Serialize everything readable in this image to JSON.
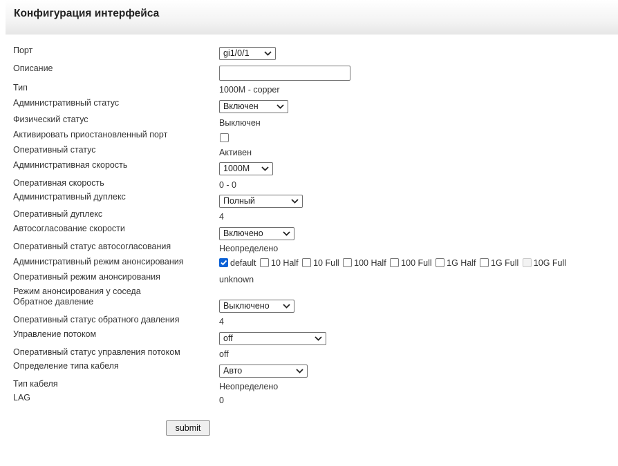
{
  "header": {
    "title": "Конфигурация интерфейса"
  },
  "form": {
    "port": {
      "label": "Порт",
      "value": "gi1/0/1"
    },
    "description": {
      "label": "Описание",
      "value": ""
    },
    "type": {
      "label": "Тип",
      "value": "1000M - copper"
    },
    "admin_status": {
      "label": "Административный статус",
      "value": "Включен"
    },
    "phys_status": {
      "label": "Физический статус",
      "value": "Выключен"
    },
    "activate_suspended": {
      "label": "Активировать приостановленный порт",
      "checked": false
    },
    "oper_status": {
      "label": "Оперативный статус",
      "value": "Активен"
    },
    "admin_speed": {
      "label": "Административная скорость",
      "value": "1000M"
    },
    "oper_speed": {
      "label": "Оперативная скорость",
      "value": "0 - 0"
    },
    "admin_duplex": {
      "label": "Административный дуплекс",
      "value": "Полный"
    },
    "oper_duplex": {
      "label": "Оперативный дуплекс",
      "value": "4"
    },
    "autoneg": {
      "label": "Автосогласование скорости",
      "value": "Включено"
    },
    "autoneg_status": {
      "label": "Оперативный статус автосогласования",
      "value": "Неопределено"
    },
    "admin_adv": {
      "label": "Административный режим анонсирования",
      "options": [
        {
          "label": "default",
          "checked": true,
          "disabled": false
        },
        {
          "label": "10 Half",
          "checked": false,
          "disabled": false
        },
        {
          "label": "10 Full",
          "checked": false,
          "disabled": false
        },
        {
          "label": "100 Half",
          "checked": false,
          "disabled": false
        },
        {
          "label": "100 Full",
          "checked": false,
          "disabled": false
        },
        {
          "label": "1G Half",
          "checked": false,
          "disabled": false
        },
        {
          "label": "1G Full",
          "checked": false,
          "disabled": false
        },
        {
          "label": "10G Full",
          "checked": false,
          "disabled": true
        }
      ]
    },
    "oper_adv": {
      "label": "Оперативный режим анонсирования",
      "value": "unknown"
    },
    "neighbor_adv": {
      "label": "Режим анонсирования у соседа"
    },
    "backpressure": {
      "label": "Обратное давление",
      "value": "Выключено"
    },
    "backpressure_status": {
      "label": "Оперативный статус обратного давления",
      "value": "4"
    },
    "flow_control": {
      "label": "Управление потоком",
      "value": "off"
    },
    "flow_control_status": {
      "label": "Оперативный статус управления потоком",
      "value": "off"
    },
    "cable_detect": {
      "label": "Определение типа кабеля",
      "value": "Авто"
    },
    "cable_type": {
      "label": "Тип кабеля",
      "value": "Неопределено"
    },
    "lag": {
      "label": "LAG",
      "value": "0"
    }
  },
  "submit_label": "submit"
}
